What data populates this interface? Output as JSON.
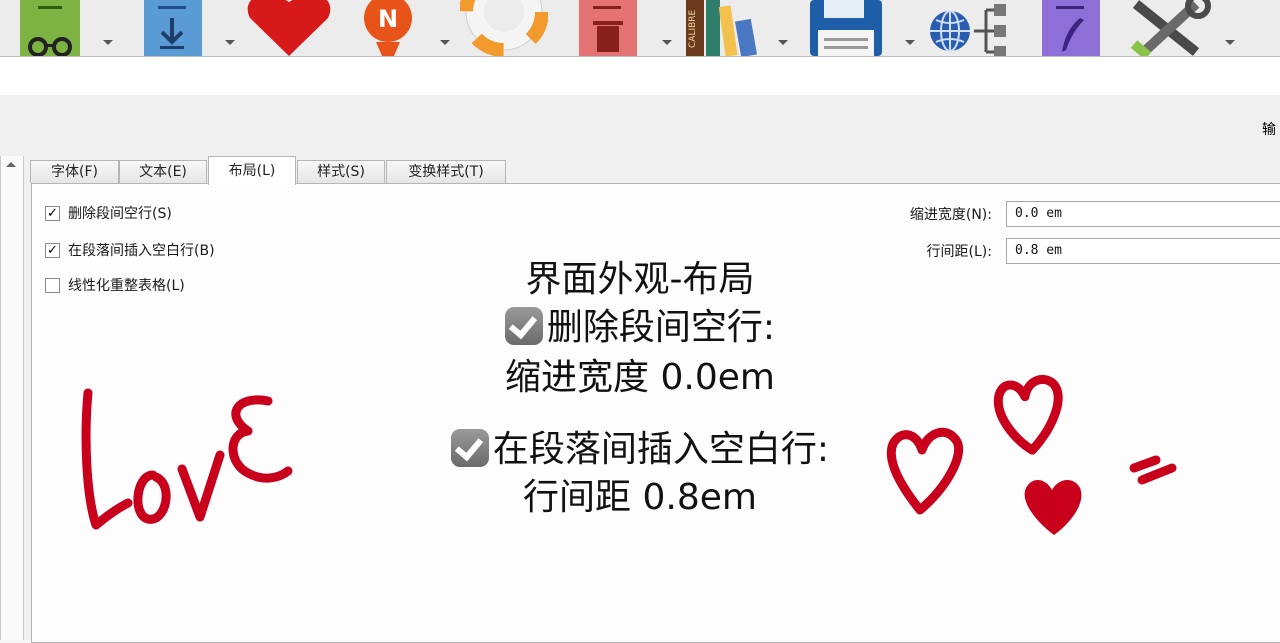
{
  "toolbar": {
    "icons": [
      "view-book-icon",
      "add-books-icon",
      "favorite-heart-icon",
      "news-badge-icon",
      "help-lifebuoy-icon",
      "remove-books-icon",
      "library-books-icon",
      "save-to-disk-icon",
      "connect-share-icon",
      "edit-metadata-icon",
      "preferences-tools-icon"
    ],
    "calibre_spine_text": "CALIBRE"
  },
  "header": {
    "output_label": "输"
  },
  "tabs": [
    {
      "label": "字体(F)",
      "active": false
    },
    {
      "label": "文本(E)",
      "active": false
    },
    {
      "label": "布局(L)",
      "active": true
    },
    {
      "label": "样式(S)",
      "active": false
    },
    {
      "label": "变换样式(T)",
      "active": false
    }
  ],
  "options": {
    "remove_blank_lines": {
      "label": "删除段间空行(S)",
      "checked": true
    },
    "insert_blank_line": {
      "label": "在段落间插入空白行(B)",
      "checked": true
    },
    "linearize_tables": {
      "label": "线性化重整表格(L)",
      "checked": false
    }
  },
  "fields": {
    "indent": {
      "label": "缩进宽度(N):",
      "value": "0.0 em"
    },
    "line_spacing": {
      "label": "行间距(L):",
      "value": "0.8 em"
    }
  },
  "overlay": {
    "title": "界面外观-布局",
    "line1": "删除段间空行:",
    "line2": "缩进宽度 0.0em",
    "line3": "在段落间插入空白行:",
    "line4": "行间距 0.8em",
    "love_text": "LOVE",
    "accent_color": "#c8001c"
  }
}
